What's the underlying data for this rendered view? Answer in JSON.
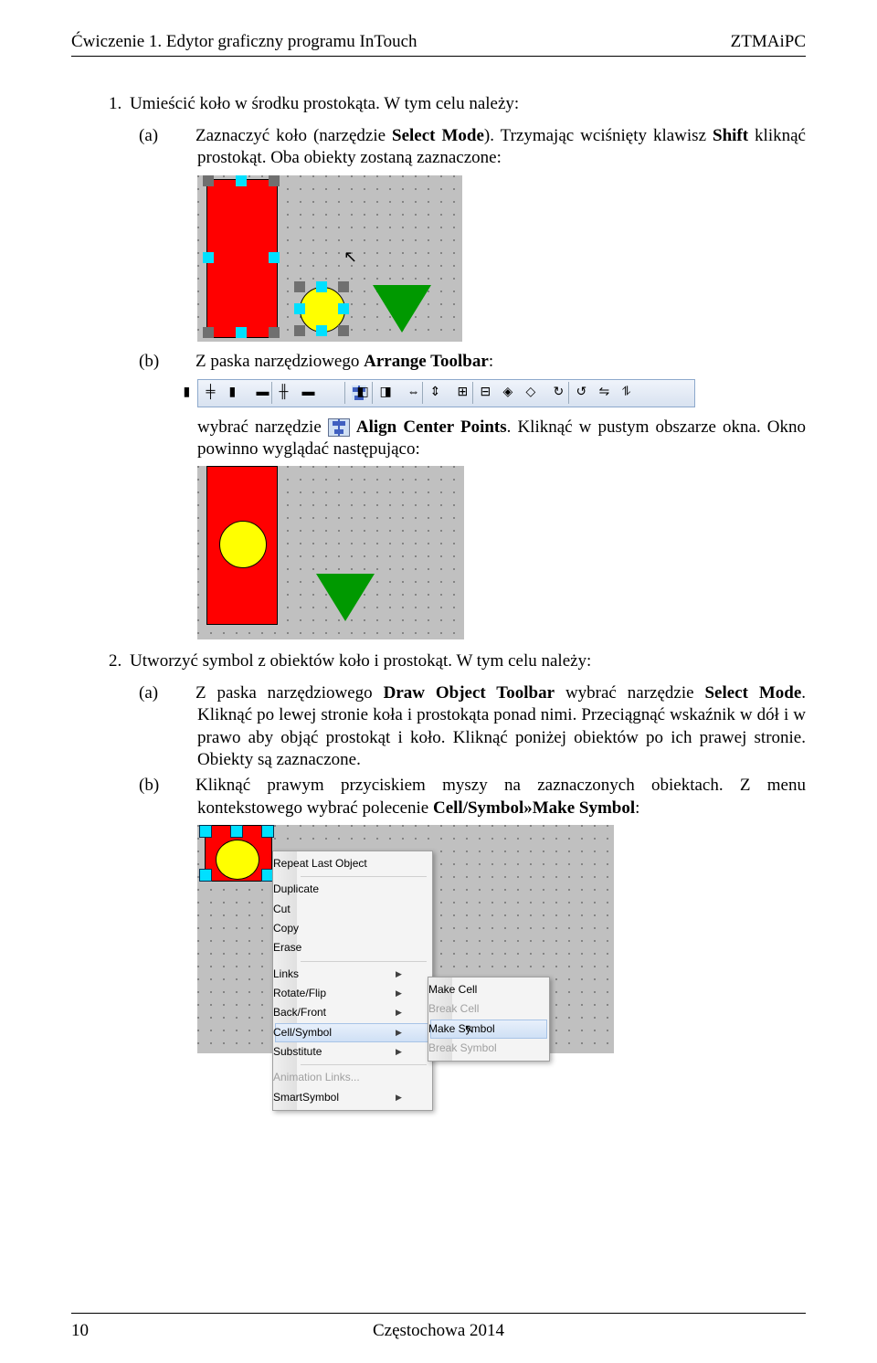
{
  "header": {
    "left": "Ćwiczenie 1. Edytor graficzny programu InTouch",
    "right": "ZTMAiPC"
  },
  "footer": {
    "page": "10",
    "center": "Częstochowa 2014"
  },
  "list1": {
    "num": "1.",
    "text_a": "Umieścić koło w środku prostokąta. W tym celu należy:",
    "a": {
      "marker": "(a)",
      "t1": "Zaznaczyć koło (narzędzie ",
      "b1": "Select Mode",
      "t2": "). Trzymając wciśnięty klawisz ",
      "b2": "Shift",
      "t3": " kliknąć prostokąt. Oba obiekty zostaną zaznaczone:"
    },
    "b": {
      "marker": "(b)",
      "t1": "Z paska narzędziowego ",
      "b1": "Arrange Toolbar",
      "t2": ":",
      "t3": "wybrać narzędzie ",
      "b2": "Align Center Points",
      "t4": ". Kliknąć w pustym obszarze okna. Okno powinno wyglądać następująco:"
    }
  },
  "list2": {
    "num": "2.",
    "text_a": "Utworzyć symbol z obiektów koło i prostokąt. W tym celu należy:",
    "a": {
      "marker": "(a)",
      "t1": "Z paska narzędziowego ",
      "b1": "Draw Object Toolbar",
      "t2": " wybrać narzędzie ",
      "b2": "Select Mode",
      "t3": ". Kliknąć po lewej stronie koła i prostokąta ponad nimi. Przeciągnąć wskaźnik w dół i w prawo aby objąć prostokąt i koło. Kliknąć poniżej obiektów po ich prawej stronie. Obiekty są zaznaczone."
    },
    "b": {
      "marker": "(b)",
      "t1": "Kliknąć prawym przyciskiem myszy na zaznaczonych obiektach. Z menu kontekstowego wybrać polecenie ",
      "b1": "Cell/Symbol»Make Symbol",
      "t2": ":"
    }
  },
  "context_menu": {
    "items": [
      "Repeat Last Object",
      "Duplicate",
      "Cut",
      "Copy",
      "Erase",
      "Links",
      "Rotate/Flip",
      "Back/Front",
      "Cell/Symbol",
      "Substitute",
      "Animation Links...",
      "SmartSymbol"
    ],
    "sub": [
      "Make Cell",
      "Break Cell",
      "Make Symbol",
      "Break Symbol"
    ]
  }
}
